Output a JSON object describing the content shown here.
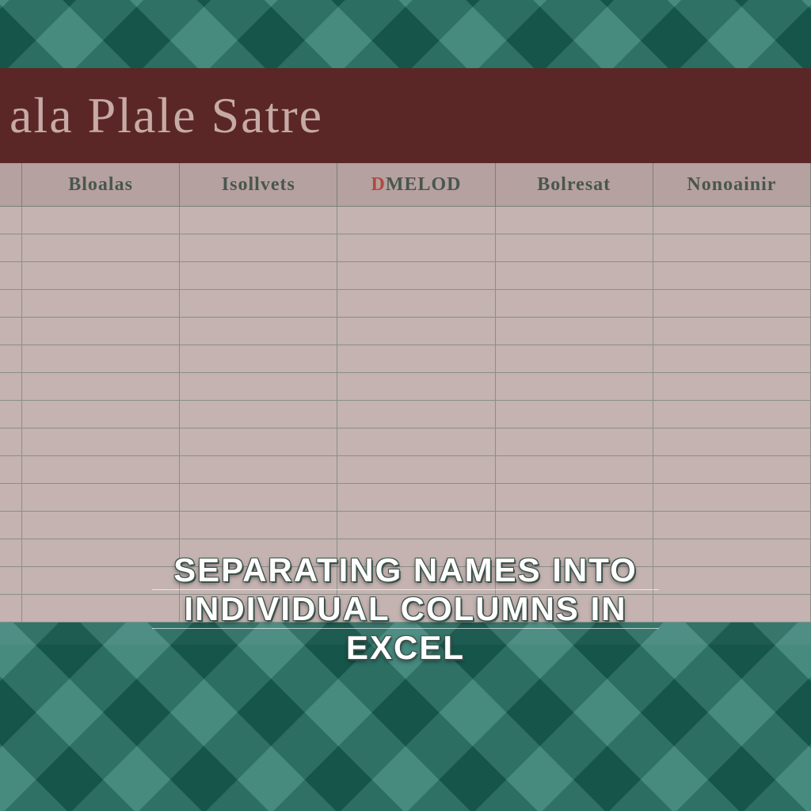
{
  "title": "ala Plale Satre",
  "columns": [
    {
      "label_prefix": "",
      "label": "Bloalas"
    },
    {
      "label_prefix": "",
      "label": "Isollvets"
    },
    {
      "label_prefix": "D",
      "label": "MELOD"
    },
    {
      "label_prefix": "",
      "label": "Bolresat"
    },
    {
      "label_prefix": "",
      "label": "Nonoainir"
    }
  ],
  "row_count": 15,
  "overlay": {
    "line1": "SEPARATING NAMES INTO",
    "line2": "INDIVIDUAL COLUMNS IN",
    "line3": "EXCEL"
  },
  "colors": {
    "bg": "#1b6e60",
    "titlebar": "#5b2726",
    "header": "#b5a19f",
    "cell": "#c4b3b1",
    "accent": "#b04a3f"
  }
}
